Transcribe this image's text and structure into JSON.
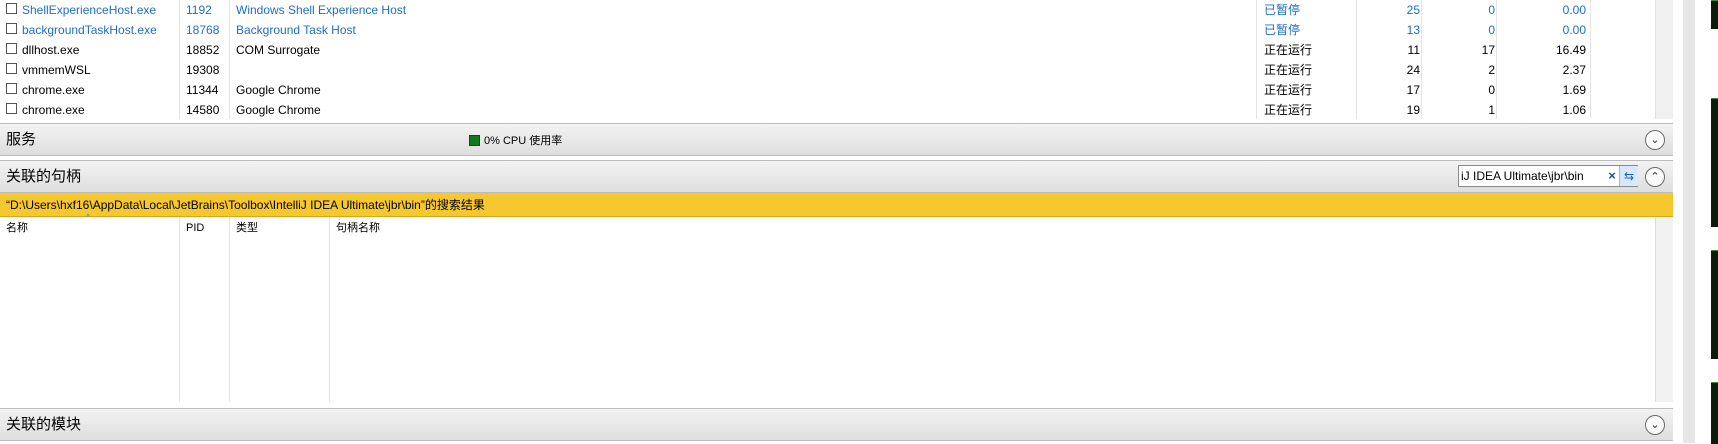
{
  "processes": [
    {
      "name": "ShellExperienceHost.exe",
      "pid": "1192",
      "desc": "Windows Shell Experience Host",
      "status": "已暂停",
      "n1": "25",
      "n2": "0",
      "n3": "0.00",
      "suspended": true
    },
    {
      "name": "backgroundTaskHost.exe",
      "pid": "18768",
      "desc": "Background Task Host",
      "status": "已暂停",
      "n1": "13",
      "n2": "0",
      "n3": "0.00",
      "suspended": true
    },
    {
      "name": "dllhost.exe",
      "pid": "18852",
      "desc": "COM Surrogate",
      "status": "正在运行",
      "n1": "11",
      "n2": "17",
      "n3": "16.49",
      "suspended": false
    },
    {
      "name": "vmmemWSL",
      "pid": "19308",
      "desc": "",
      "status": "正在运行",
      "n1": "24",
      "n2": "2",
      "n3": "2.37",
      "suspended": false
    },
    {
      "name": "chrome.exe",
      "pid": "11344",
      "desc": "Google Chrome",
      "status": "正在运行",
      "n1": "17",
      "n2": "0",
      "n3": "1.69",
      "suspended": false
    },
    {
      "name": "chrome.exe",
      "pid": "14580",
      "desc": "Google Chrome",
      "status": "正在运行",
      "n1": "19",
      "n2": "1",
      "n3": "1.06",
      "suspended": false
    }
  ],
  "services": {
    "title": "服务",
    "cpu_text": "0% CPU 使用率",
    "cpu_color": "#0f7a1b"
  },
  "handles": {
    "title": "关联的句柄",
    "search_value": "iJ IDEA Ultimate\\jbr\\bin",
    "clear_icon": "×",
    "refresh_icon": "⇆",
    "result_text": "“D:\\Users\\hxf16\\AppData\\Local\\JetBrains\\Toolbox\\IntelliJ IDEA Ultimate\\jbr\\bin”的搜索结果",
    "columns": {
      "name": "名称",
      "pid": "PID",
      "type": "类型",
      "handle_name": "句柄名称"
    },
    "sort_indicator": "^"
  },
  "modules": {
    "title": "关联的模块"
  },
  "colors": {
    "suspended_text": "#1e6fc4",
    "result_bar": "#f6c830",
    "graph_bg": "#0b1a0b"
  }
}
